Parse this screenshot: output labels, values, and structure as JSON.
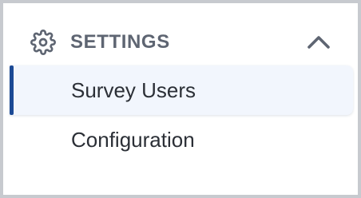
{
  "section": {
    "title": "SETTINGS",
    "icon": "gear-icon",
    "toggle_icon": "chevron-up-icon",
    "expanded": true
  },
  "nav": {
    "items": [
      {
        "label": "Survey Users",
        "active": true
      },
      {
        "label": "Configuration",
        "active": false
      }
    ]
  },
  "colors": {
    "accent": "#1c4a95",
    "header_text": "#5e6572",
    "item_text": "#2b2f36",
    "active_background": "#f2f6fd",
    "border": "#c7cacf"
  }
}
